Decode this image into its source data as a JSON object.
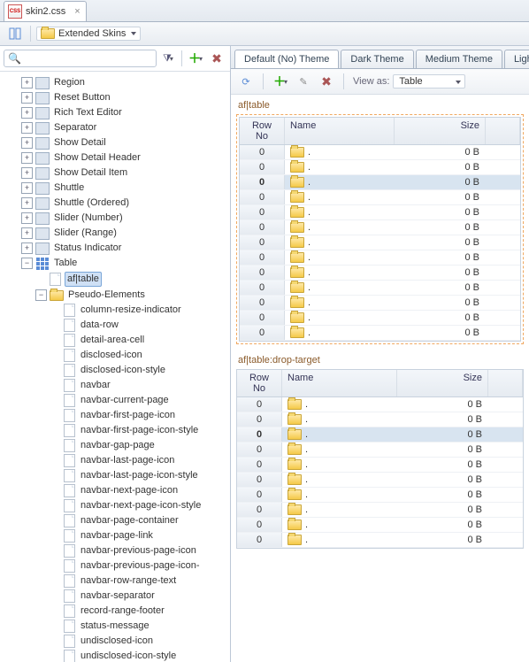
{
  "file_tab": {
    "label": "skin2.css"
  },
  "toolbar": {
    "ext_skins": "Extended Skins"
  },
  "left": {
    "search_placeholder": "",
    "nodes": [
      {
        "depth": 0,
        "toggle": "+",
        "icon": "misc",
        "label": "Region"
      },
      {
        "depth": 0,
        "toggle": "+",
        "icon": "misc",
        "label": "Reset Button"
      },
      {
        "depth": 0,
        "toggle": "+",
        "icon": "misc",
        "label": "Rich Text Editor"
      },
      {
        "depth": 0,
        "toggle": "+",
        "icon": "misc",
        "label": "Separator"
      },
      {
        "depth": 0,
        "toggle": "+",
        "icon": "misc",
        "label": "Show Detail"
      },
      {
        "depth": 0,
        "toggle": "+",
        "icon": "misc",
        "label": "Show Detail Header"
      },
      {
        "depth": 0,
        "toggle": "+",
        "icon": "misc",
        "label": "Show Detail Item"
      },
      {
        "depth": 0,
        "toggle": "+",
        "icon": "misc",
        "label": "Shuttle"
      },
      {
        "depth": 0,
        "toggle": "+",
        "icon": "misc",
        "label": "Shuttle (Ordered)"
      },
      {
        "depth": 0,
        "toggle": "+",
        "icon": "misc",
        "label": "Slider (Number)"
      },
      {
        "depth": 0,
        "toggle": "+",
        "icon": "misc",
        "label": "Slider (Range)"
      },
      {
        "depth": 0,
        "toggle": "+",
        "icon": "misc",
        "label": "Status Indicator"
      },
      {
        "depth": 0,
        "toggle": "-",
        "icon": "grid",
        "label": "Table"
      },
      {
        "depth": 1,
        "toggle": " ",
        "icon": "page",
        "label": "af|table",
        "selected": true
      },
      {
        "depth": 1,
        "toggle": "-",
        "icon": "folder-open",
        "label": "Pseudo-Elements"
      },
      {
        "depth": 2,
        "toggle": " ",
        "icon": "page",
        "label": "column-resize-indicator"
      },
      {
        "depth": 2,
        "toggle": " ",
        "icon": "page",
        "label": "data-row"
      },
      {
        "depth": 2,
        "toggle": " ",
        "icon": "page",
        "label": "detail-area-cell"
      },
      {
        "depth": 2,
        "toggle": " ",
        "icon": "page",
        "label": "disclosed-icon"
      },
      {
        "depth": 2,
        "toggle": " ",
        "icon": "page",
        "label": "disclosed-icon-style"
      },
      {
        "depth": 2,
        "toggle": " ",
        "icon": "page",
        "label": "navbar"
      },
      {
        "depth": 2,
        "toggle": " ",
        "icon": "page",
        "label": "navbar-current-page"
      },
      {
        "depth": 2,
        "toggle": " ",
        "icon": "page",
        "label": "navbar-first-page-icon"
      },
      {
        "depth": 2,
        "toggle": " ",
        "icon": "page",
        "label": "navbar-first-page-icon-style"
      },
      {
        "depth": 2,
        "toggle": " ",
        "icon": "page",
        "label": "navbar-gap-page"
      },
      {
        "depth": 2,
        "toggle": " ",
        "icon": "page",
        "label": "navbar-last-page-icon"
      },
      {
        "depth": 2,
        "toggle": " ",
        "icon": "page",
        "label": "navbar-last-page-icon-style"
      },
      {
        "depth": 2,
        "toggle": " ",
        "icon": "page",
        "label": "navbar-next-page-icon"
      },
      {
        "depth": 2,
        "toggle": " ",
        "icon": "page",
        "label": "navbar-next-page-icon-style"
      },
      {
        "depth": 2,
        "toggle": " ",
        "icon": "page",
        "label": "navbar-page-container"
      },
      {
        "depth": 2,
        "toggle": " ",
        "icon": "page",
        "label": "navbar-page-link"
      },
      {
        "depth": 2,
        "toggle": " ",
        "icon": "page",
        "label": "navbar-previous-page-icon"
      },
      {
        "depth": 2,
        "toggle": " ",
        "icon": "page",
        "label": "navbar-previous-page-icon-"
      },
      {
        "depth": 2,
        "toggle": " ",
        "icon": "page",
        "label": "navbar-row-range-text"
      },
      {
        "depth": 2,
        "toggle": " ",
        "icon": "page",
        "label": "navbar-separator"
      },
      {
        "depth": 2,
        "toggle": " ",
        "icon": "page",
        "label": "record-range-footer"
      },
      {
        "depth": 2,
        "toggle": " ",
        "icon": "page",
        "label": "status-message"
      },
      {
        "depth": 2,
        "toggle": " ",
        "icon": "page",
        "label": "undisclosed-icon"
      },
      {
        "depth": 2,
        "toggle": " ",
        "icon": "page",
        "label": "undisclosed-icon-style"
      }
    ]
  },
  "themes": {
    "tabs": [
      "Default (No) Theme",
      "Dark Theme",
      "Medium Theme",
      "Light Theme"
    ],
    "active": 0,
    "view_as_label": "View as:",
    "view_as_value": "Table"
  },
  "preview": {
    "blocks": [
      {
        "title": "af|table",
        "dashed": true,
        "headers": {
          "rowno": "Row No",
          "name": "Name",
          "size": "Size"
        },
        "rows": [
          {
            "no": "0",
            "name": ".",
            "size": "0 B",
            "sel": false
          },
          {
            "no": "0",
            "name": ".",
            "size": "0 B",
            "sel": false
          },
          {
            "no": "0",
            "name": ".",
            "size": "0 B",
            "sel": true
          },
          {
            "no": "0",
            "name": ".",
            "size": "0 B",
            "sel": false
          },
          {
            "no": "0",
            "name": ".",
            "size": "0 B",
            "sel": false
          },
          {
            "no": "0",
            "name": ".",
            "size": "0 B",
            "sel": false
          },
          {
            "no": "0",
            "name": ".",
            "size": "0 B",
            "sel": false
          },
          {
            "no": "0",
            "name": ".",
            "size": "0 B",
            "sel": false
          },
          {
            "no": "0",
            "name": ".",
            "size": "0 B",
            "sel": false
          },
          {
            "no": "0",
            "name": ".",
            "size": "0 B",
            "sel": false
          },
          {
            "no": "0",
            "name": ".",
            "size": "0 B",
            "sel": false
          },
          {
            "no": "0",
            "name": ".",
            "size": "0 B",
            "sel": false
          },
          {
            "no": "0",
            "name": ".",
            "size": "0 B",
            "sel": false
          }
        ]
      },
      {
        "title": "af|table:drop-target",
        "dashed": false,
        "headers": {
          "rowno": "Row No",
          "name": "Name",
          "size": "Size"
        },
        "rows": [
          {
            "no": "0",
            "name": ".",
            "size": "0 B",
            "sel": false
          },
          {
            "no": "0",
            "name": ".",
            "size": "0 B",
            "sel": false
          },
          {
            "no": "0",
            "name": ".",
            "size": "0 B",
            "sel": true
          },
          {
            "no": "0",
            "name": ".",
            "size": "0 B",
            "sel": false
          },
          {
            "no": "0",
            "name": ".",
            "size": "0 B",
            "sel": false
          },
          {
            "no": "0",
            "name": ".",
            "size": "0 B",
            "sel": false
          },
          {
            "no": "0",
            "name": ".",
            "size": "0 B",
            "sel": false
          },
          {
            "no": "0",
            "name": ".",
            "size": "0 B",
            "sel": false
          },
          {
            "no": "0",
            "name": ".",
            "size": "0 B",
            "sel": false
          },
          {
            "no": "0",
            "name": ".",
            "size": "0 B",
            "sel": false
          }
        ]
      }
    ]
  }
}
